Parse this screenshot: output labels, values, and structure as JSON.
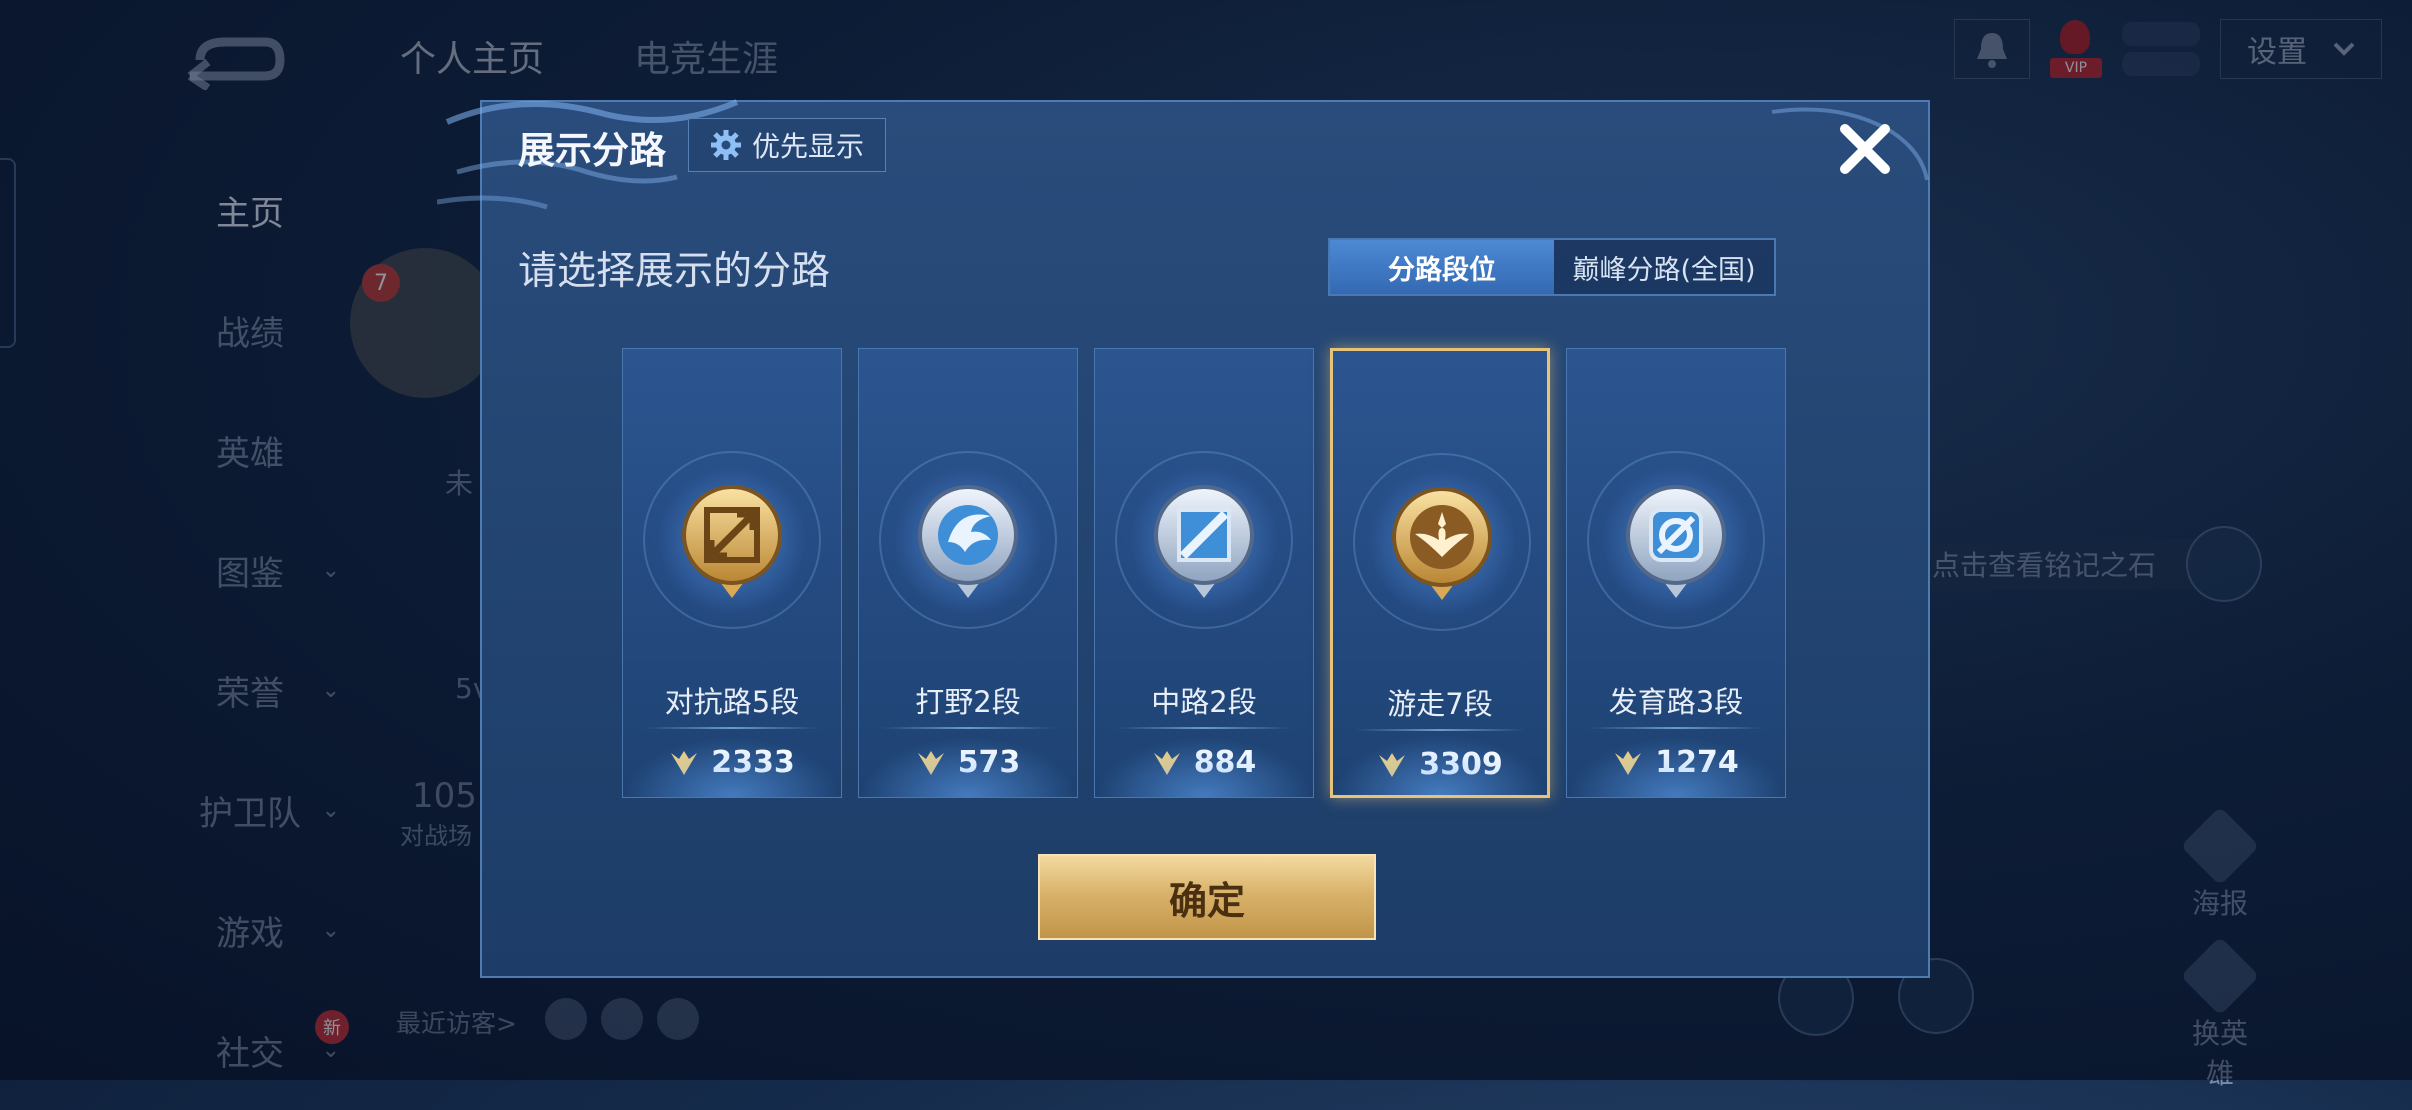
{
  "background": {
    "top_tabs": [
      "个人主页",
      "电竞生涯"
    ],
    "sidebar": [
      {
        "label": "主页",
        "chevron": false,
        "active": true
      },
      {
        "label": "战绩",
        "chevron": false
      },
      {
        "label": "英雄",
        "chevron": false
      },
      {
        "label": "图鉴",
        "chevron": true
      },
      {
        "label": "荣誉",
        "chevron": true
      },
      {
        "label": "护卫队",
        "chevron": true
      },
      {
        "label": "游戏",
        "chevron": true
      },
      {
        "label": "社交",
        "chevron": true,
        "badge": "新"
      }
    ],
    "settings_label": "设置",
    "vip_tag": "VIP",
    "level_badge": "7",
    "partial_texts": {
      "status": "未",
      "mode": "5v",
      "count": "105",
      "count_label": "对战场"
    },
    "recent_visitors": "最近访客>",
    "mingji_hint": "点击查看铭记之石",
    "right_actions": [
      "海报",
      "换英雄"
    ]
  },
  "modal": {
    "title": "展示分路",
    "priority_button": "优先显示",
    "subtitle": "请选择展示的分路",
    "segment": {
      "options": [
        "分路段位",
        "巅峰分路(全国)"
      ],
      "selected": "分路段位"
    },
    "lanes": [
      {
        "label": "对抗路5段",
        "score": "2333",
        "emblem": "sword-emblem",
        "tone": "gold",
        "selected": false
      },
      {
        "label": "打野2段",
        "score": "573",
        "emblem": "dragon-emblem",
        "tone": "silver",
        "selected": false
      },
      {
        "label": "中路2段",
        "score": "884",
        "emblem": "slash-emblem",
        "tone": "silver",
        "selected": false
      },
      {
        "label": "游走7段",
        "score": "3309",
        "emblem": "wings-emblem",
        "tone": "gold",
        "selected": true
      },
      {
        "label": "发育路3段",
        "score": "1274",
        "emblem": "target-emblem",
        "tone": "silver",
        "selected": false
      }
    ],
    "confirm_label": "确定"
  },
  "colors": {
    "modal_bg": "#244673",
    "modal_border": "#4e7bb2",
    "segment_active": "#3f7ac4",
    "selected_border": "#e6c27a",
    "confirm_gold": "#d9b36b"
  }
}
